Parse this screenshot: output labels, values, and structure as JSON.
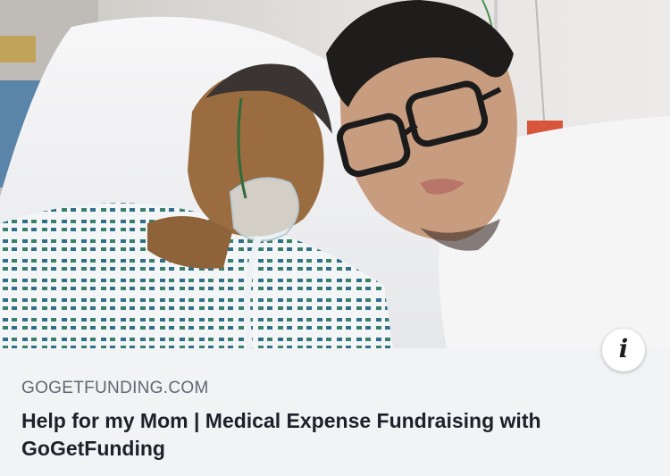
{
  "link_preview": {
    "domain": "GOGETFUNDING.COM",
    "title": "Help for my Mom | Medical Expense Fundraising with GoGetFunding",
    "info_icon": "info-icon"
  },
  "image": {
    "description_icon": "photo"
  },
  "colors": {
    "background": "#f2f3f5",
    "domain_text": "#606770",
    "title_text": "#1d2129",
    "info_button_bg": "#ffffff"
  }
}
